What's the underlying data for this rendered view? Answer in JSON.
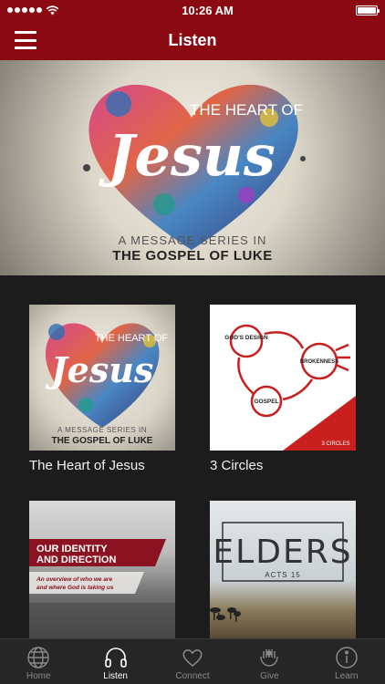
{
  "status_bar": {
    "time": "10:26 AM",
    "battery_level": 1.0
  },
  "nav": {
    "title": "Listen"
  },
  "hero": {
    "art_title": "THE HEART OF",
    "art_word": "Jesus",
    "subtitle": "A MESSAGE SERIES IN",
    "main_text": "THE GOSPEL OF LUKE",
    "page_count": 2,
    "active_page": 1
  },
  "cards": [
    {
      "title": "The Heart of Jesus",
      "art": {
        "top": "THE HEART OF",
        "word": "Jesus",
        "sub": "A MESSAGE SERIES IN",
        "main": "THE GOSPEL OF LUKE"
      }
    },
    {
      "title": "3 Circles",
      "art": {
        "design": "GOD'S DESIGN",
        "broken": "BROKENNESS",
        "gospel": "GOSPEL",
        "badge": "3 CIRCLES"
      }
    },
    {
      "title": "",
      "art": {
        "line1": "OUR IDENTITY",
        "line2": "AND DIRECTION",
        "desc1": "An overview of who we are",
        "desc2": "and where God is taking us"
      }
    },
    {
      "title": "",
      "art": {
        "word": "ELDERS",
        "sub": "ACTS 15"
      }
    }
  ],
  "tabs": [
    {
      "label": "Home",
      "icon": "globe-icon",
      "active": false
    },
    {
      "label": "Listen",
      "icon": "headphones-icon",
      "active": true
    },
    {
      "label": "Connect",
      "icon": "heart-icon",
      "active": false
    },
    {
      "label": "Give",
      "icon": "hands-icon",
      "active": false
    },
    {
      "label": "Learn",
      "icon": "info-icon",
      "active": false
    }
  ],
  "colors": {
    "brand": "#8b0a12",
    "tab_bg": "#262626",
    "grid_bg": "#1c1c1c"
  }
}
